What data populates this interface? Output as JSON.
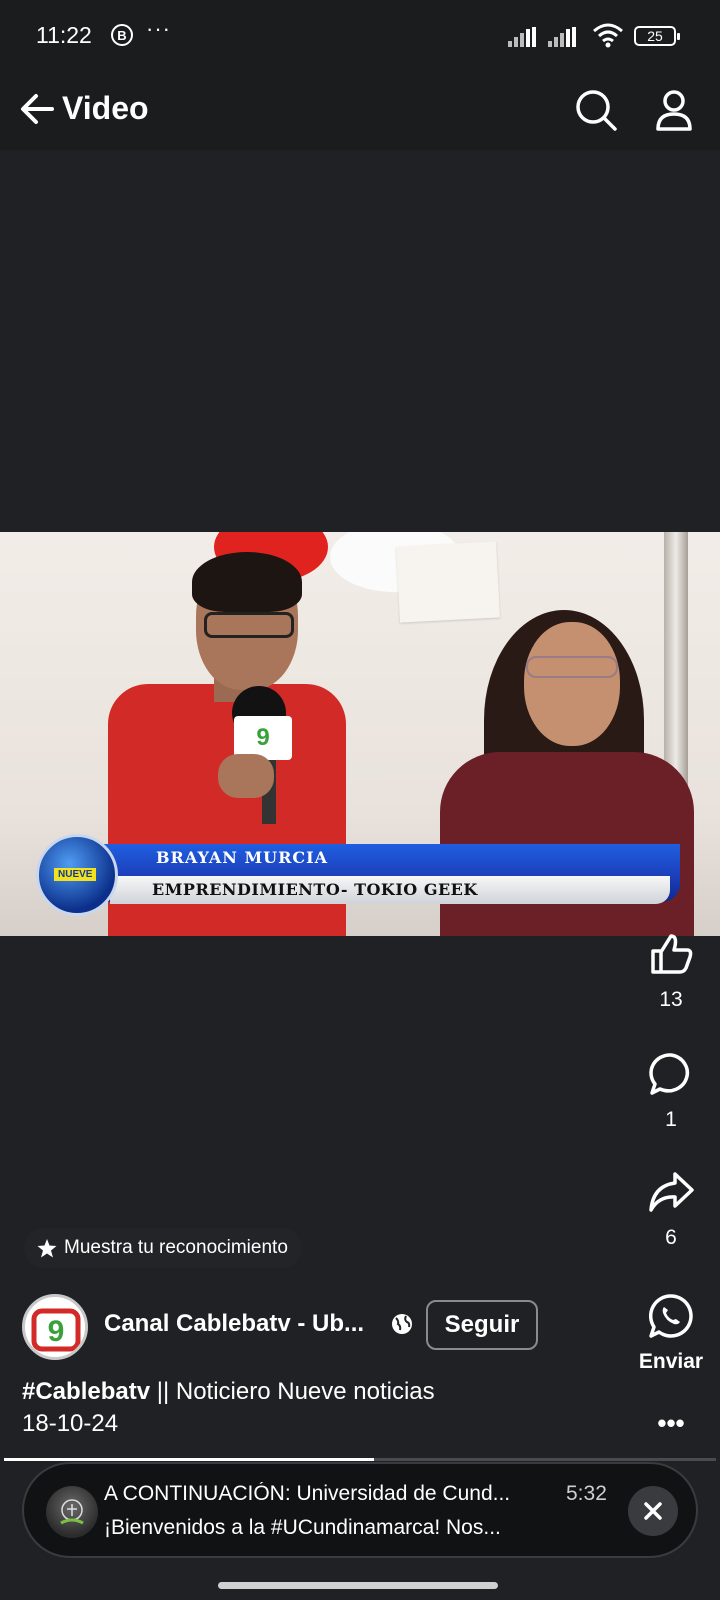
{
  "status_bar": {
    "time": "11:22",
    "indicator": "B",
    "overflow": "···",
    "battery": "25",
    "icons": [
      "signal-icon",
      "signal-icon",
      "wifi-icon",
      "battery-icon"
    ]
  },
  "header": {
    "title": "Video",
    "icons": [
      "back-arrow-icon",
      "search-icon",
      "profile-icon"
    ]
  },
  "video": {
    "lower_third_name": "BRAYAN MURCIA",
    "lower_third_subtitle": "EMPRENDIMIENTO- TOKIO GEEK",
    "logo_text": "NUEVE",
    "mic_logo": "9"
  },
  "actions": {
    "like_count": "13",
    "comment_count": "1",
    "share_count": "6",
    "send_label": "Enviar",
    "more": "•••"
  },
  "recognition": {
    "label": "Muestra tu reconocimiento"
  },
  "channel": {
    "name": "Canal Cablebatv - Ub...",
    "follow_label": "Seguir",
    "avatar_text": "9"
  },
  "caption": {
    "hashtag": "#Cablebatv",
    "rest": " || Noticiero Nueve noticias",
    "date": "18-10-24"
  },
  "progress": {
    "fraction": 0.52
  },
  "up_next": {
    "title": "A CONTINUACIÓN: Universidad de Cund...",
    "duration": "5:32",
    "subtitle": "¡Bienvenidos a la #UCundinamarca! Nos..."
  },
  "colors": {
    "background": "#202124",
    "accent_red": "#d22a26",
    "lower_third_blue": "#1f5fe0"
  }
}
